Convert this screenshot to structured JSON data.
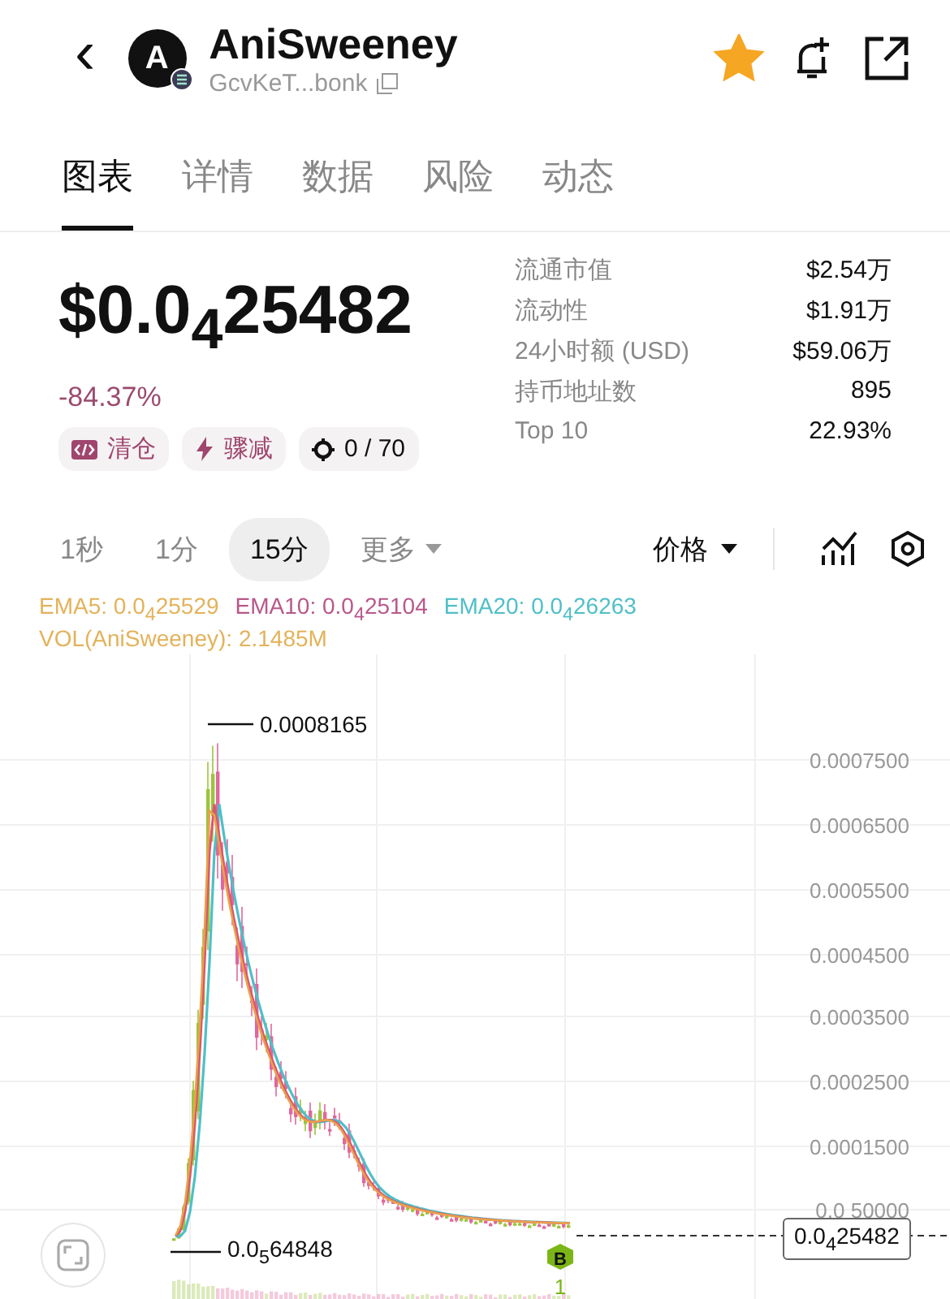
{
  "header": {
    "back": "‹",
    "avatar_letter": "A",
    "title": "AniSweeney",
    "address": "GcvKeT...bonk",
    "favorited": true
  },
  "tabs": [
    {
      "label": "图表",
      "selected": true
    },
    {
      "label": "详情",
      "selected": false
    },
    {
      "label": "数据",
      "selected": false
    },
    {
      "label": "风险",
      "selected": false
    },
    {
      "label": "动态",
      "selected": false
    }
  ],
  "price": {
    "value": "$0.0$_{4}$25482",
    "change": "-84.37%"
  },
  "badges": [
    {
      "kind": "code",
      "label": "清仓"
    },
    {
      "kind": "bolt",
      "label": "骤减"
    },
    {
      "kind": "target",
      "label": "0 / 70"
    }
  ],
  "stats": [
    {
      "label": "流通市值",
      "value": "$2.54万"
    },
    {
      "label": "流动性",
      "value": "$1.91万"
    },
    {
      "label": "24小时额 (USD)",
      "value": "$59.06万"
    },
    {
      "label": "持币地址数",
      "value": "895"
    },
    {
      "label": "Top 10",
      "value": "22.93%"
    }
  ],
  "timeframes": [
    {
      "label": "1秒",
      "selected": false
    },
    {
      "label": "1分",
      "selected": false
    },
    {
      "label": "15分",
      "selected": true
    },
    {
      "label": "更多",
      "selected": false
    }
  ],
  "price_mode": "价格",
  "legend": [
    {
      "text": "EMA5: 0.0$_{4}$25529",
      "color": "#e3b25a"
    },
    {
      "text": "EMA10: 0.0$_{4}$25104",
      "color": "#b8588a"
    },
    {
      "text": "EMA20: 0.0$_{4}$26263",
      "color": "#4fbfc8"
    }
  ],
  "volume_label": "VOL(AniSweeney): 2.1485M",
  "chart": {
    "y_labels": [
      "0.0007500",
      "0.0006500",
      "0.0005500",
      "0.0004500",
      "0.0003500",
      "0.0002500",
      "0.0001500",
      "0.0 50000"
    ],
    "high_label": "0.0008165",
    "low_label": "0.0$_{5}$64848",
    "last_price": "0.0$_{4}$25482",
    "marker": "B",
    "marker_count": "1"
  }
}
